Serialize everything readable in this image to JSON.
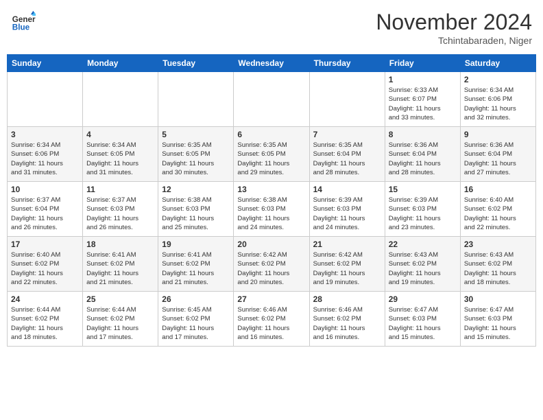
{
  "header": {
    "logo_line1": "General",
    "logo_line2": "Blue",
    "month": "November 2024",
    "location": "Tchintabaraden, Niger"
  },
  "weekdays": [
    "Sunday",
    "Monday",
    "Tuesday",
    "Wednesday",
    "Thursday",
    "Friday",
    "Saturday"
  ],
  "weeks": [
    [
      {
        "day": "",
        "info": ""
      },
      {
        "day": "",
        "info": ""
      },
      {
        "day": "",
        "info": ""
      },
      {
        "day": "",
        "info": ""
      },
      {
        "day": "",
        "info": ""
      },
      {
        "day": "1",
        "info": "Sunrise: 6:33 AM\nSunset: 6:07 PM\nDaylight: 11 hours\nand 33 minutes."
      },
      {
        "day": "2",
        "info": "Sunrise: 6:34 AM\nSunset: 6:06 PM\nDaylight: 11 hours\nand 32 minutes."
      }
    ],
    [
      {
        "day": "3",
        "info": "Sunrise: 6:34 AM\nSunset: 6:06 PM\nDaylight: 11 hours\nand 31 minutes."
      },
      {
        "day": "4",
        "info": "Sunrise: 6:34 AM\nSunset: 6:05 PM\nDaylight: 11 hours\nand 31 minutes."
      },
      {
        "day": "5",
        "info": "Sunrise: 6:35 AM\nSunset: 6:05 PM\nDaylight: 11 hours\nand 30 minutes."
      },
      {
        "day": "6",
        "info": "Sunrise: 6:35 AM\nSunset: 6:05 PM\nDaylight: 11 hours\nand 29 minutes."
      },
      {
        "day": "7",
        "info": "Sunrise: 6:35 AM\nSunset: 6:04 PM\nDaylight: 11 hours\nand 28 minutes."
      },
      {
        "day": "8",
        "info": "Sunrise: 6:36 AM\nSunset: 6:04 PM\nDaylight: 11 hours\nand 28 minutes."
      },
      {
        "day": "9",
        "info": "Sunrise: 6:36 AM\nSunset: 6:04 PM\nDaylight: 11 hours\nand 27 minutes."
      }
    ],
    [
      {
        "day": "10",
        "info": "Sunrise: 6:37 AM\nSunset: 6:04 PM\nDaylight: 11 hours\nand 26 minutes."
      },
      {
        "day": "11",
        "info": "Sunrise: 6:37 AM\nSunset: 6:03 PM\nDaylight: 11 hours\nand 26 minutes."
      },
      {
        "day": "12",
        "info": "Sunrise: 6:38 AM\nSunset: 6:03 PM\nDaylight: 11 hours\nand 25 minutes."
      },
      {
        "day": "13",
        "info": "Sunrise: 6:38 AM\nSunset: 6:03 PM\nDaylight: 11 hours\nand 24 minutes."
      },
      {
        "day": "14",
        "info": "Sunrise: 6:39 AM\nSunset: 6:03 PM\nDaylight: 11 hours\nand 24 minutes."
      },
      {
        "day": "15",
        "info": "Sunrise: 6:39 AM\nSunset: 6:03 PM\nDaylight: 11 hours\nand 23 minutes."
      },
      {
        "day": "16",
        "info": "Sunrise: 6:40 AM\nSunset: 6:02 PM\nDaylight: 11 hours\nand 22 minutes."
      }
    ],
    [
      {
        "day": "17",
        "info": "Sunrise: 6:40 AM\nSunset: 6:02 PM\nDaylight: 11 hours\nand 22 minutes."
      },
      {
        "day": "18",
        "info": "Sunrise: 6:41 AM\nSunset: 6:02 PM\nDaylight: 11 hours\nand 21 minutes."
      },
      {
        "day": "19",
        "info": "Sunrise: 6:41 AM\nSunset: 6:02 PM\nDaylight: 11 hours\nand 21 minutes."
      },
      {
        "day": "20",
        "info": "Sunrise: 6:42 AM\nSunset: 6:02 PM\nDaylight: 11 hours\nand 20 minutes."
      },
      {
        "day": "21",
        "info": "Sunrise: 6:42 AM\nSunset: 6:02 PM\nDaylight: 11 hours\nand 19 minutes."
      },
      {
        "day": "22",
        "info": "Sunrise: 6:43 AM\nSunset: 6:02 PM\nDaylight: 11 hours\nand 19 minutes."
      },
      {
        "day": "23",
        "info": "Sunrise: 6:43 AM\nSunset: 6:02 PM\nDaylight: 11 hours\nand 18 minutes."
      }
    ],
    [
      {
        "day": "24",
        "info": "Sunrise: 6:44 AM\nSunset: 6:02 PM\nDaylight: 11 hours\nand 18 minutes."
      },
      {
        "day": "25",
        "info": "Sunrise: 6:44 AM\nSunset: 6:02 PM\nDaylight: 11 hours\nand 17 minutes."
      },
      {
        "day": "26",
        "info": "Sunrise: 6:45 AM\nSunset: 6:02 PM\nDaylight: 11 hours\nand 17 minutes."
      },
      {
        "day": "27",
        "info": "Sunrise: 6:46 AM\nSunset: 6:02 PM\nDaylight: 11 hours\nand 16 minutes."
      },
      {
        "day": "28",
        "info": "Sunrise: 6:46 AM\nSunset: 6:02 PM\nDaylight: 11 hours\nand 16 minutes."
      },
      {
        "day": "29",
        "info": "Sunrise: 6:47 AM\nSunset: 6:03 PM\nDaylight: 11 hours\nand 15 minutes."
      },
      {
        "day": "30",
        "info": "Sunrise: 6:47 AM\nSunset: 6:03 PM\nDaylight: 11 hours\nand 15 minutes."
      }
    ]
  ]
}
